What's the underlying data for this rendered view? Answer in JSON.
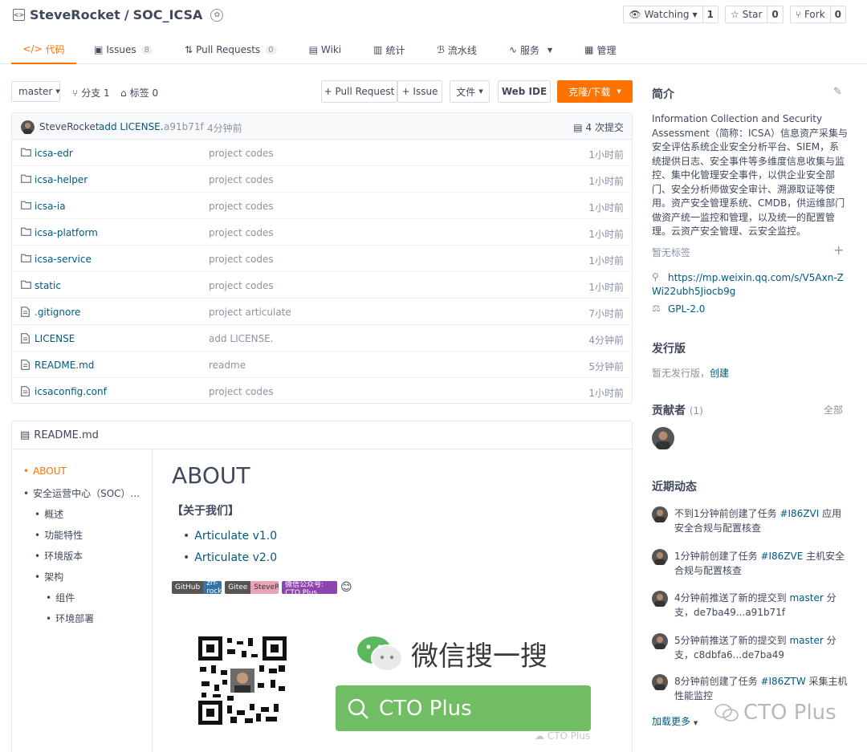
{
  "repo": {
    "owner": "SteveRocket",
    "separator": "/",
    "name": "SOC_ICSA",
    "watch_label": "Watching",
    "watch_count": "1",
    "star_label": "Star",
    "star_count": "0",
    "fork_label": "Fork",
    "fork_count": "0"
  },
  "tabs": [
    {
      "label": "代码"
    },
    {
      "label": "Issues",
      "badge": "8"
    },
    {
      "label": "Pull Requests",
      "badge": "0"
    },
    {
      "label": "Wiki"
    },
    {
      "label": "统计"
    },
    {
      "label": "流水线"
    },
    {
      "label": "服务"
    },
    {
      "label": "管理"
    }
  ],
  "toolbar": {
    "branch": "master",
    "branches": "分支 1",
    "tags": "标签 0",
    "pull_request": "+ Pull Request",
    "issue": "+ Issue",
    "file": "文件",
    "web_ide": "Web IDE",
    "clone": "克隆/下载"
  },
  "commit": {
    "author": "SteveRocket",
    "message": "add LICENSE.",
    "hash": "a91b71f",
    "time": "4分钟前",
    "count": "4 次提交"
  },
  "files": [
    {
      "name": "icsa-edr",
      "type": "dir",
      "message": "project codes",
      "time": "1小时前"
    },
    {
      "name": "icsa-helper",
      "type": "dir",
      "message": "project codes",
      "time": "1小时前"
    },
    {
      "name": "icsa-ia",
      "type": "dir",
      "message": "project codes",
      "time": "1小时前"
    },
    {
      "name": "icsa-platform",
      "type": "dir",
      "message": "project codes",
      "time": "1小时前"
    },
    {
      "name": "icsa-service",
      "type": "dir",
      "message": "project codes",
      "time": "1小时前"
    },
    {
      "name": "static",
      "type": "dir",
      "message": "project codes",
      "time": "1小时前"
    },
    {
      "name": ".gitignore",
      "type": "file",
      "message": "project articulate",
      "time": "7小时前"
    },
    {
      "name": "LICENSE",
      "type": "file",
      "message": "add LICENSE.",
      "time": "4分钟前"
    },
    {
      "name": "README.md",
      "type": "file",
      "message": "readme",
      "time": "5分钟前"
    },
    {
      "name": "icsaconfig.conf",
      "type": "file",
      "message": "project codes",
      "time": "1小时前"
    }
  ],
  "readme": {
    "filename": "README.md",
    "toc": [
      {
        "label": "ABOUT",
        "level": 0
      },
      {
        "label": "安全运营中心（SOC）...",
        "level": 0
      },
      {
        "label": "概述",
        "level": 1
      },
      {
        "label": "功能特性",
        "level": 1
      },
      {
        "label": "环境版本",
        "level": 1
      },
      {
        "label": "架构",
        "level": 1
      },
      {
        "label": "组件",
        "level": 2
      },
      {
        "label": "环境部署",
        "level": 2
      }
    ],
    "heading": "ABOUT",
    "about_us": "【关于我们】",
    "links": [
      "Articulate v1.0",
      "Articulate v2.0"
    ],
    "shields": [
      {
        "left": "GitHub",
        "right": "zrf-rocket"
      },
      {
        "left": "Gitee",
        "right": "SteveRocket"
      },
      {
        "single": "微信公众号: CTO Plus"
      }
    ],
    "wechat_search": "微信搜一搜",
    "search_term": "CTO Plus",
    "watermark_small": "CTO Plus"
  },
  "sidebar": {
    "intro_title": "简介",
    "description": "Information Collection and Security Assessment（简称：ICSA）信息资产采集与安全评估系统企业安全分析平台、SIEM，系统提供日志、安全事件等多维度信息收集与监控、集中化管理安全事件，以供企业安全部门、安全分析师做安全审计、溯源取证等使用。资产安全管理系统、CMDB，供运维部门做资产统一监控和管理，以及统一的配置管理。云资产安全管理、云安全监控。",
    "no_tags": "暂无标签",
    "url": "https://mp.weixin.qq.com/s/V5Axn-ZWi22ubh5Jiocb9g",
    "license": "GPL-2.0",
    "releases_title": "发行版",
    "no_releases": "暂无发行版，",
    "create": "创建",
    "contributors_title": "贡献者",
    "contributors_count": "(1)",
    "all": "全部",
    "activity_title": "近期动态",
    "activities": [
      {
        "pre": "不到1分钟前创建了任务 ",
        "link": "#I86ZVI",
        "post": " 应用安全合规与配置核查"
      },
      {
        "pre": "1分钟前创建了任务 ",
        "link": "#I86ZVE",
        "post": " 主机安全合规与配置核查"
      },
      {
        "pre": "4分钟前推送了新的提交到 ",
        "link": "master",
        "post": " 分支，de7ba49...a91b71f"
      },
      {
        "pre": "5分钟前推送了新的提交到 ",
        "link": "master",
        "post": " 分支，c8dbfa6...de7ba49"
      },
      {
        "pre": "8分钟前创建了任务 ",
        "link": "#I86ZTW",
        "post": " 采集主机性能监控"
      }
    ],
    "load_more": "加载更多",
    "watermark_big": "CTO Plus"
  },
  "colors": {
    "accent": "#fe7300",
    "link": "#005980",
    "wechat_green": "#71bd64"
  }
}
